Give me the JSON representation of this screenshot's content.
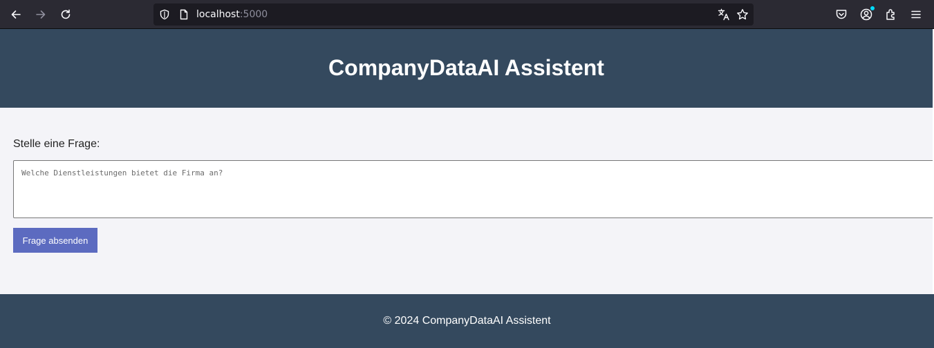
{
  "browser": {
    "url_host": "localhost",
    "url_port": ":5000",
    "icons": {
      "back": "arrow-left-icon",
      "forward": "arrow-right-icon",
      "reload": "reload-icon",
      "shield": "shield-icon",
      "page": "page-icon",
      "translate": "translate-icon",
      "bookmark": "star-icon",
      "pocket": "pocket-icon",
      "account": "account-icon",
      "extensions": "puzzle-icon",
      "menu": "hamburger-menu-icon"
    },
    "colors": {
      "toolbar": "#2b2a33",
      "urlbar": "#1c1b22"
    }
  },
  "header": {
    "title": "CompanyDataAI Assistent"
  },
  "main": {
    "question_label": "Stelle eine Frage:",
    "question_placeholder": "Welche Dienstleistungen bietet die Firma an?",
    "submit_label": "Frage absenden"
  },
  "footer": {
    "text": "© 2024 CompanyDataAI Assistent"
  },
  "colors": {
    "header_bg": "#34495e",
    "page_bg": "#f4f4f8",
    "button_bg": "#5c6bc0"
  }
}
